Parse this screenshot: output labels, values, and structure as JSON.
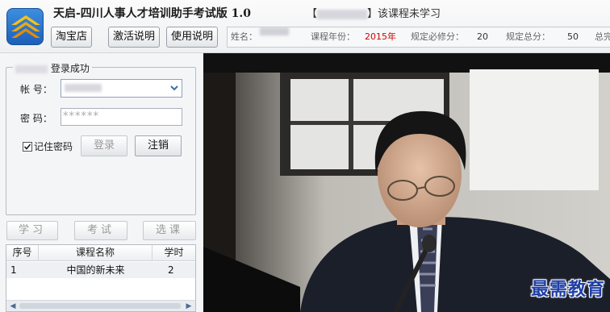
{
  "header": {
    "title": "天启-四川人事人才培训助手考试版 1.0",
    "notice_prefix": "【",
    "notice_suffix": "】该课程未学习"
  },
  "toolbar": {
    "taobao_label": "淘宝店",
    "activate_label": "激活说明",
    "usage_label": "使用说明"
  },
  "info": {
    "name_label": "姓名：",
    "year_label": "课程年份：",
    "year_value": "2015年",
    "required_label": "规定必修分：",
    "required_value": "20",
    "total_label": "规定总分：",
    "total_value": "50",
    "trailing_label": "总完"
  },
  "login": {
    "status": "登录成功",
    "account_label": "帐  号：",
    "password_label": "密  码：",
    "password_value": "******",
    "remember_label": "记住密码",
    "remember_checked": true,
    "login_button": "登录",
    "logout_button": "注销"
  },
  "tabs": {
    "study": "学习",
    "exam": "考试",
    "select": "选课"
  },
  "course_table": {
    "headers": {
      "index": "序号",
      "name": "课程名称",
      "hours": "学时"
    },
    "rows": [
      {
        "index": "1",
        "name": "中国的新未来",
        "hours": "2"
      }
    ]
  },
  "video": {
    "watermark": "最需教育"
  },
  "icons": {
    "logo": "stacked-chevrons-logo",
    "dropdown": "chevron-down-icon",
    "checkbox": "checkmark-icon",
    "scroll_left": "arrow-left-icon",
    "scroll_right": "arrow-right-icon"
  },
  "colors": {
    "accent_red": "#d00000",
    "watermark_blue": "#1f3fa6",
    "logo_blue": "#1c5fb8",
    "logo_gold": "#f5c21b"
  }
}
